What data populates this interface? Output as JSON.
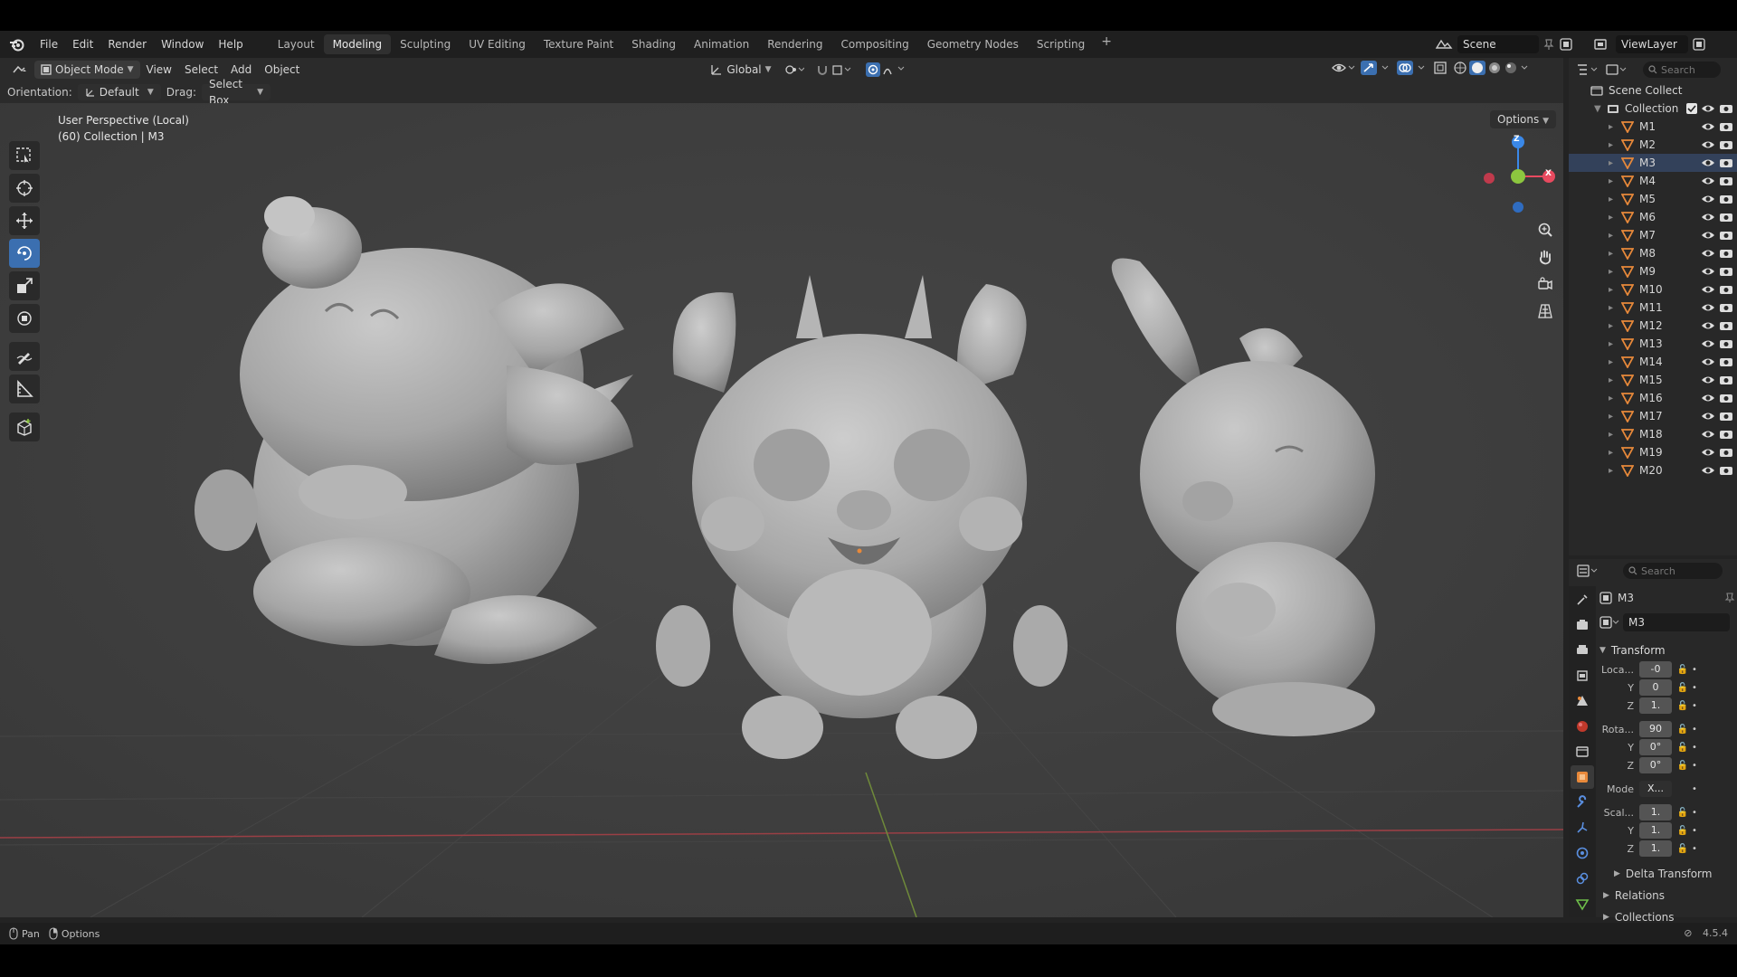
{
  "menu": {
    "items": [
      "File",
      "Edit",
      "Render",
      "Window",
      "Help"
    ]
  },
  "workspaces": {
    "tabs": [
      "Layout",
      "Modeling",
      "Sculpting",
      "UV Editing",
      "Texture Paint",
      "Shading",
      "Animation",
      "Rendering",
      "Compositing",
      "Geometry Nodes",
      "Scripting"
    ],
    "active": "Modeling",
    "add": "+"
  },
  "scene": {
    "name": "Scene"
  },
  "view_layer": {
    "name": "ViewLayer"
  },
  "viewport_header": {
    "mode": "Object Mode",
    "menus": [
      "View",
      "Select",
      "Add",
      "Object"
    ],
    "transform_orientation": "Global"
  },
  "tool_header": {
    "orientation_label": "Orientation:",
    "orientation_value": "Default",
    "drag_label": "Drag:",
    "drag_value": "Select Box",
    "options_label": "Options"
  },
  "viewport": {
    "perspective": "User Perspective (Local)",
    "collection_info": "(60) Collection | M3",
    "gizmo_axes": {
      "x": "X",
      "z": "Z"
    }
  },
  "outliner": {
    "search_placeholder": "Search",
    "root": "Scene Collect",
    "collection": "Collection",
    "objects": [
      "M1",
      "M2",
      "M3",
      "M4",
      "M5",
      "M6",
      "M7",
      "M8",
      "M9",
      "M10",
      "M11",
      "M12",
      "M13",
      "M14",
      "M15",
      "M16",
      "M17",
      "M18",
      "M19",
      "M20"
    ],
    "selected": "M3"
  },
  "properties": {
    "search_placeholder": "Search",
    "object_name": "M3",
    "object_data_name": "M3",
    "transform": {
      "title": "Transform",
      "location_label": "Loca...",
      "location": [
        "-0",
        "0",
        "1."
      ],
      "rotation_label": "Rota...",
      "rotation": [
        "90",
        "0°",
        "0°"
      ],
      "mode_label": "Mode",
      "mode_value": "X...",
      "scale_label": "Scal...",
      "scale": [
        "1.",
        "1.",
        "1."
      ],
      "y_label": "Y",
      "z_label": "Z"
    },
    "delta_transform": "Delta Transform",
    "relations": "Relations",
    "collections": "Collections"
  },
  "statusbar": {
    "pan": "Pan",
    "options": "Options",
    "version": "4.5.4"
  },
  "colors": {
    "accent": "#3b6fb0",
    "object_icon": "#e8893a",
    "axis_x": "#e84a5f",
    "axis_y": "#8cc63f",
    "axis_z": "#3a88e8"
  }
}
